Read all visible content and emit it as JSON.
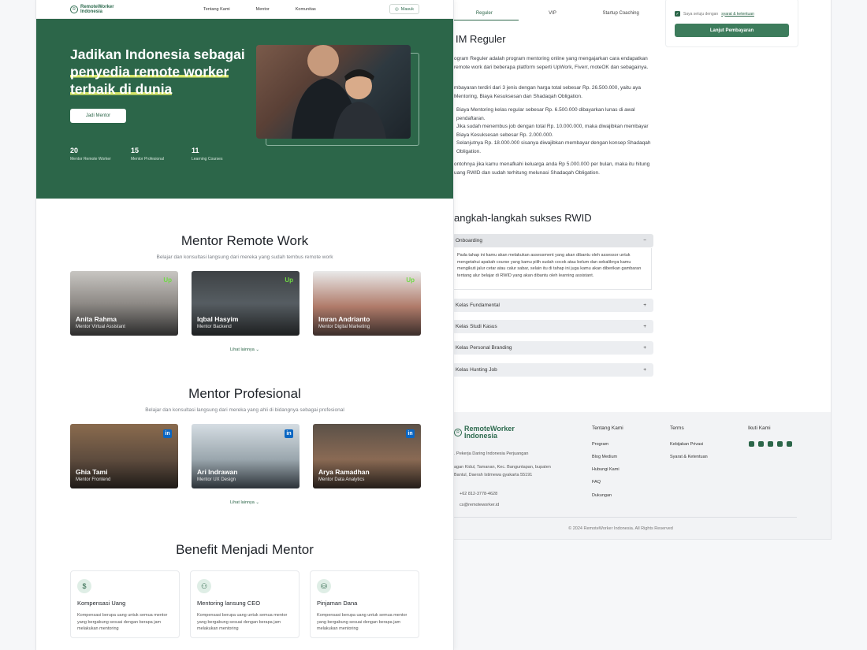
{
  "nav": {
    "logo_line1": "RemoteWorker",
    "logo_line2": "Indonesia",
    "links": [
      "Tentang Kami",
      "Mentor",
      "Komunitas"
    ],
    "login": "Masuk"
  },
  "hero": {
    "title_plain": "Jadikan Indonesia sebagai ",
    "title_highlight": "penyedia remote worker terbaik di dunia",
    "cta": "Jadi Mentor",
    "stats": [
      {
        "value": "20",
        "label": "Mentor Remote Worker"
      },
      {
        "value": "15",
        "label": "Mentor Profesional"
      },
      {
        "value": "11",
        "label": "Learning Courses"
      }
    ]
  },
  "remote_section": {
    "title": "Mentor Remote Work",
    "subtitle": "Belajar dan konsultasi langsung dari mereka yang sudah tembus remote work",
    "more": "Lihat lainnya ⌄",
    "mentors": [
      {
        "name": "Anita Rahma",
        "role": "Mentor Virtual Assistant",
        "badge": "Up"
      },
      {
        "name": "Iqbal Hasyim",
        "role": "Mentor Backend",
        "badge": "Up"
      },
      {
        "name": "Imran Andrianto",
        "role": "Mentor Digital Marketing",
        "badge": "Up"
      }
    ]
  },
  "pro_section": {
    "title": "Mentor Profesional",
    "subtitle": "Belajar dan konsultasi langsung dari mereka yang ahli di bidangnya sebagai profesional",
    "more": "Lihat lainnya ⌄",
    "mentors": [
      {
        "name": "Ghia Tami",
        "role": "Mentor Frontend",
        "badge": "in"
      },
      {
        "name": "Ari Indrawan",
        "role": "Mentor UX Design",
        "badge": "in"
      },
      {
        "name": "Arya Ramadhan",
        "role": "Mentor Data Analytics",
        "badge": "in"
      }
    ]
  },
  "benefit": {
    "title": "Benefit Menjadi Mentor",
    "items": [
      {
        "title": "Kompensasi Uang",
        "desc": "Kompensasi berupa uang untuk semua mentor yang bergabung sesuai dengan berapa jam melakukan mentoring",
        "icon": "dollar-icon"
      },
      {
        "title": "Mentoring lansung CEO",
        "desc": "Kompensasi berupa uang untuk semua mentor yang bergabung sesuai dengan berapa jam melakukan mentoring",
        "icon": "user-plus-icon"
      },
      {
        "title": "Pinjaman Dana",
        "desc": "Kompensasi berupa uang untuk semua mentor yang bergabung sesuai dengan berapa jam melakukan mentoring",
        "icon": "hand-coin-icon"
      }
    ]
  },
  "program": {
    "tabs": [
      "Reguler",
      "VIP",
      "Startup Coaching"
    ],
    "title": "IM Reguler",
    "p1": "ogram Reguler adalah program mentoring online yang mengajarkan cara endapatkan remote work dari beberapa platform seperti UpWork, Fiverr, moteOK dan sebagainya.",
    "p2": "mbayaran terdiri dari 3 jenis dengan harga total sebesar Rp. 26.500.000, yaitu aya Mentoring, Biaya Kesuksesan dan Shadaqah Obligation.",
    "p3": "Biaya Mentoring kelas regular sebesar Rp. 6.500.000 dibayarkan lunas di awal pendaftaran.",
    "p4": "Jika sudah menembus job dengan total Rp. 10.000.000, maka diwajibkan membayar Biaya Kesuksesan sebesar Rp. 2.000.000.",
    "p5": "Selanjutnya Rp. 18.000.000 sisanya diwajibkan membayar dengan konsep Shadaqah Obligation.",
    "p6": "ontohnya jika kamu menafkahi keluarga anda Rp 5.000.000 per bulan, maka itu hitung uang RWID dan sudah terhitung melunasi Shadaqah Obligation."
  },
  "payment": {
    "agree_text": "Saya setuju dengan",
    "agree_link": "syarat & ketentuan",
    "button": "Lanjut Pembayaran"
  },
  "steps": {
    "title": "angkah-langkah sukses RWID",
    "items": [
      {
        "label": "Onboarding",
        "sign": "−"
      },
      {
        "label": "Kelas Fundamental",
        "sign": "+"
      },
      {
        "label": "Kelas Studi Kasus",
        "sign": "+"
      },
      {
        "label": "Kelas Personal Branding",
        "sign": "+"
      },
      {
        "label": "Kelas Hunting Job",
        "sign": "+"
      }
    ],
    "onboarding_text": "Pada tahap ini kamu akan melakukan assessment yang akan dibantu oleh assessor untuk mengetahui apakah course yang kamu pilih sudah cocok atau belum dan sebaliknya kamu mengikuti jalur cetar atau calur sabar, selain itu di tahap ini juga kamu akan diberikan gambaran tentang alur belajar di RWID yang akan dibantu oleh learning assistant."
  },
  "footer": {
    "logo_line1": "RemoteWorker",
    "logo_line2": "Indonesia",
    "org": ". Pekerja Daring Indonesia Perjuangan",
    "address": "agan Kidul, Tamanan, Kec. Banguntapan, bupaten Bantul, Daerah Istimewa gyakarta 55191",
    "phone": "+62 812-3778-4628",
    "email": "cs@remoteworker.id",
    "col1_title": "Tentang Kami",
    "col1": [
      "Program",
      "Blog Medium",
      "Hubungi Kami",
      "FAQ",
      "Dukungan"
    ],
    "col2_title": "Terms",
    "col2": [
      "Kebijakan Privasi",
      "Syarat & Ketentuan"
    ],
    "col3_title": "Ikuti Kami",
    "copyright": "2024 RemoteWorker Indonesia. All Rights Reserved"
  },
  "colors": {
    "brand": "#2c6649",
    "highlight": "#d7e66a",
    "upwork": "#6fda44",
    "linkedin": "#0a66c2"
  }
}
